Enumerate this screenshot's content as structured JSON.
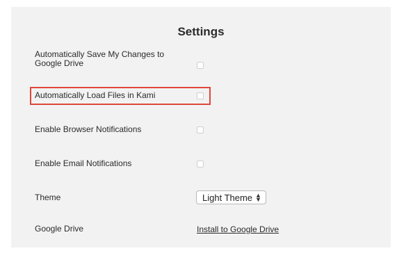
{
  "settings": {
    "title": "Settings",
    "rows": [
      {
        "label": "Automatically Save My Changes to Google Drive",
        "checked": false
      },
      {
        "label": "Automatically Load Files in Kami",
        "checked": false
      },
      {
        "label": "Enable Browser Notifications",
        "checked": false
      },
      {
        "label": "Enable Email Notifications",
        "checked": false
      }
    ],
    "theme": {
      "label": "Theme",
      "selected": "Light Theme"
    },
    "google_drive": {
      "label": "Google Drive",
      "link": "Install to Google Drive"
    }
  },
  "colors": {
    "panel_background": "#f2f2f2",
    "highlight_border": "#e0453a"
  }
}
